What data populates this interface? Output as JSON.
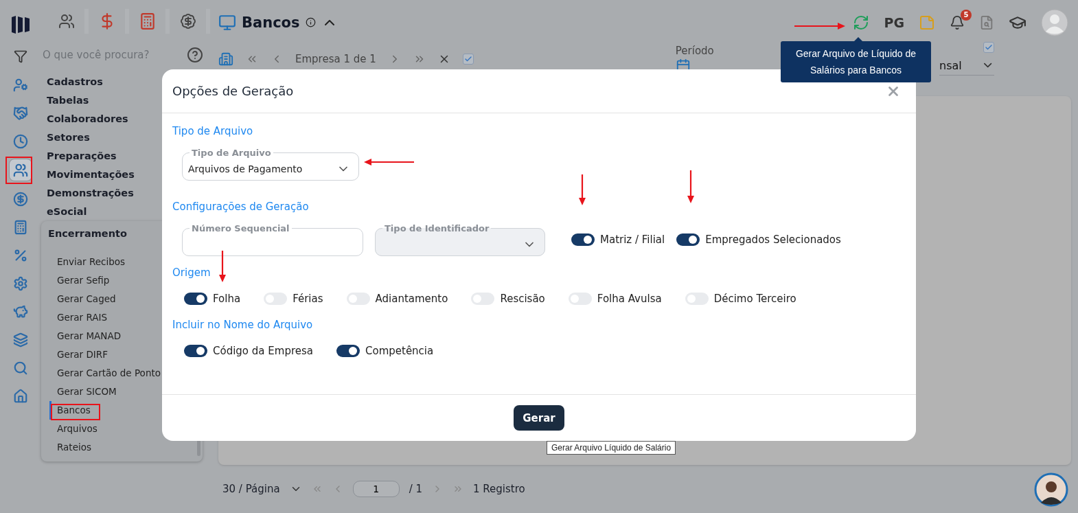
{
  "header": {
    "title": "Bancos",
    "pg_label": "PG",
    "notification_count": "5"
  },
  "rail_items": [
    {
      "selected": false
    },
    {
      "selected": false
    },
    {
      "selected": false
    },
    {
      "selected": true
    },
    {
      "selected": false
    },
    {
      "selected": false
    },
    {
      "selected": false
    },
    {
      "selected": false
    },
    {
      "selected": false
    },
    {
      "selected": false
    },
    {
      "selected": false
    },
    {
      "selected": false
    }
  ],
  "search": {
    "placeholder": "O que você procura?"
  },
  "menu": [
    {
      "label": "Cadastros"
    },
    {
      "label": "Tabelas"
    },
    {
      "label": "Colaboradores"
    },
    {
      "label": "Setores"
    },
    {
      "label": "Preparações"
    },
    {
      "label": "Movimentações"
    },
    {
      "label": "Demonstrações"
    },
    {
      "label": "eSocial"
    }
  ],
  "submenu": {
    "title": "Encerramento",
    "items": [
      {
        "label": "Enviar Recibos",
        "selected": false
      },
      {
        "label": "Gerar Sefip",
        "selected": false
      },
      {
        "label": "Gerar Caged",
        "selected": false
      },
      {
        "label": "Gerar RAIS",
        "selected": false
      },
      {
        "label": "Gerar MANAD",
        "selected": false
      },
      {
        "label": "Gerar DIRF",
        "selected": false
      },
      {
        "label": "Gerar Cartão de Ponto",
        "selected": false
      },
      {
        "label": "Gerar SICOM",
        "selected": false
      },
      {
        "label": "Bancos",
        "selected": true
      },
      {
        "label": "Arquivos",
        "selected": false
      },
      {
        "label": "Rateios",
        "selected": false
      }
    ]
  },
  "toolbar": {
    "company_nav": "Empresa 1 de 1",
    "checked": true
  },
  "period": {
    "label": "Período",
    "value": "nsal",
    "checked": true
  },
  "pagination": {
    "page_size": "30 / Página",
    "page": "1",
    "total": "/ 1",
    "records": "1 Registro"
  },
  "tooltip": {
    "text": "Gerar Arquivo de Líquido de Salários para Bancos"
  },
  "modal": {
    "title": "Opções de Geração",
    "sections": [
      {
        "title": "Tipo de Arquivo",
        "items": [
          {
            "kind": "select",
            "label": "Tipo de Arquivo",
            "value": "Arquivos de Pagamento",
            "disabled": false
          }
        ]
      },
      {
        "title": "Configurações de Geração",
        "items": [
          {
            "kind": "input",
            "label": "Número Sequencial",
            "disabled": false
          },
          {
            "kind": "select",
            "label": "Tipo de Identificador",
            "disabled": true
          },
          {
            "kind": "toggle",
            "label": "Matriz / Filial",
            "on": true
          },
          {
            "kind": "toggle",
            "label": "Empregados Selecionados",
            "on": true
          }
        ]
      },
      {
        "title": "Origem",
        "items": [
          {
            "kind": "toggle",
            "label": "Folha",
            "on": true
          },
          {
            "kind": "toggle",
            "label": "Férias",
            "on": false
          },
          {
            "kind": "toggle",
            "label": "Adiantamento",
            "on": false
          },
          {
            "kind": "toggle",
            "label": "Rescisão",
            "on": false
          },
          {
            "kind": "toggle",
            "label": "Folha Avulsa",
            "on": false
          },
          {
            "kind": "toggle",
            "label": "Décimo Terceiro",
            "on": false
          }
        ]
      },
      {
        "title": "Incluir no Nome do Arquivo",
        "items": [
          {
            "kind": "toggle",
            "label": "Código da Empresa",
            "on": true
          },
          {
            "kind": "toggle",
            "label": "Competência",
            "on": true
          }
        ]
      }
    ],
    "button": "Gerar",
    "button_tooltip": "Gerar Arquivo Líquido de Salário"
  }
}
